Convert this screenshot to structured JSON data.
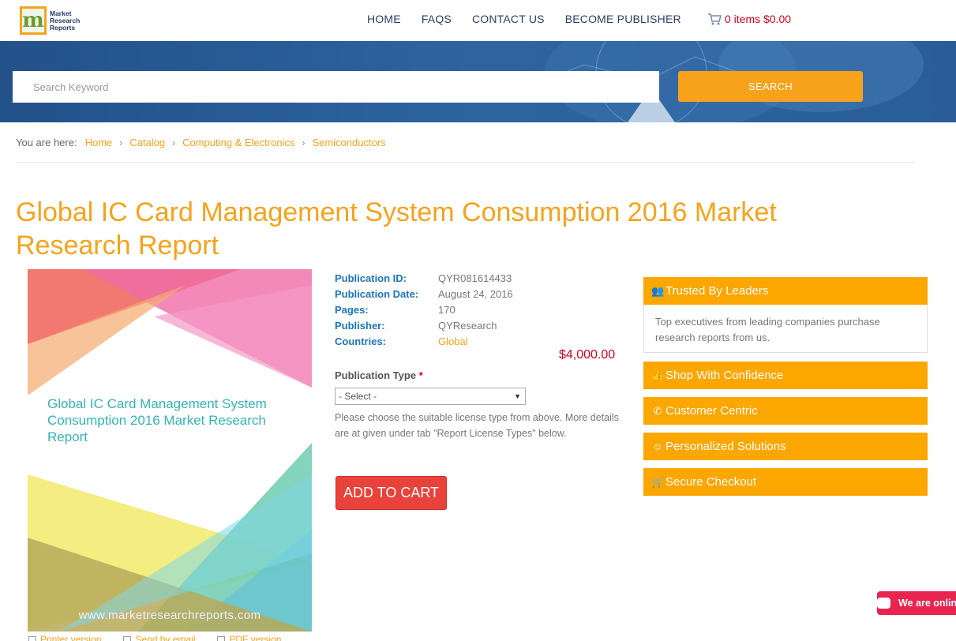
{
  "header": {
    "logo": {
      "mark": "m",
      "line1": "Market",
      "line2": "Research",
      "line3": "Reports"
    },
    "nav": [
      "HOME",
      "FAQS",
      "CONTACT US",
      "BECOME PUBLISHER"
    ],
    "cart": "0 items $0.00"
  },
  "search": {
    "placeholder": "Search Keyword",
    "button": "SEARCH"
  },
  "breadcrumb": {
    "label": "You are here:",
    "items": [
      "Home",
      "Catalog",
      "Computing & Electronics",
      "Semiconductors"
    ]
  },
  "title": "Global IC Card Management System Consumption 2016 Market Research Report",
  "cover": {
    "title": "Global IC Card Management System Consumption 2016 Market Research Report",
    "url": "www.marketresearchreports.com",
    "links": [
      "Printer version",
      "Send by email",
      "PDF version"
    ]
  },
  "details": [
    {
      "key": "Publication ID:",
      "value": "QYR081614433"
    },
    {
      "key": "Publication Date:",
      "value": "August 24, 2016"
    },
    {
      "key": "Pages:",
      "value": "170"
    },
    {
      "key": "Publisher:",
      "value": "QYResearch"
    },
    {
      "key": "Countries:",
      "value": "Global"
    }
  ],
  "price": "$4,000.00",
  "publication_type": {
    "label": "Publication Type",
    "required_mark": "*",
    "selected": "- Select -",
    "hint": "Please choose the suitable license type from above. More details are at given under tab \"Report License Types\" below."
  },
  "add_to_cart": "ADD TO CART",
  "panels": {
    "trusted": {
      "title": "Trusted By Leaders",
      "body": "Top executives from leading companies purchase research reports from us."
    },
    "shop": "Shop With Confidence",
    "customer": "Customer Centric",
    "personalized": "Personalized Solutions",
    "secure": "Secure Checkout"
  },
  "chat": "We are online",
  "colors": {
    "accent": "#f7a21b",
    "panel": "#fca600",
    "banner": "#2d64a0",
    "price": "#d0021b",
    "add_to_cart": "#e8423a"
  }
}
